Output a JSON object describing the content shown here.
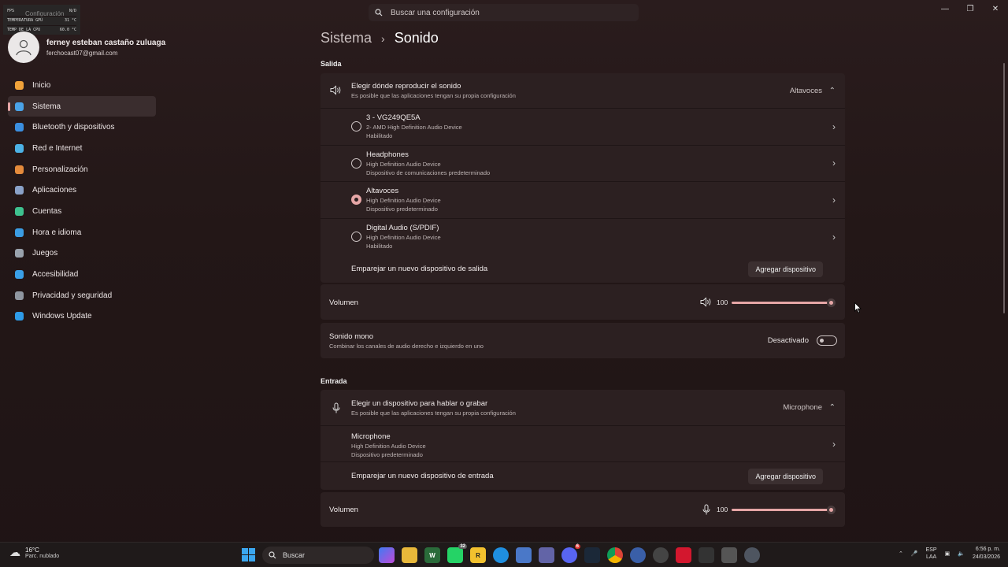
{
  "overlay": {
    "rows": [
      {
        "label": "FPS",
        "value": "N/D"
      },
      {
        "label": "TEMPERATURA GPU",
        "value": "31 °C"
      },
      {
        "label": "TEMP DE LA CPU",
        "value": "60.0 °C"
      }
    ],
    "app_title": "Configuración"
  },
  "search": {
    "placeholder": "Buscar una configuración"
  },
  "profile": {
    "name": "ferney esteban castaño zuluaga",
    "email": "ferchocast07@gmail.com"
  },
  "nav": [
    {
      "label": "Inicio",
      "icon": "home-icon",
      "color": "#f0a23a"
    },
    {
      "label": "Sistema",
      "icon": "system-icon",
      "color": "#4aa3e8",
      "active": true
    },
    {
      "label": "Bluetooth y dispositivos",
      "icon": "bluetooth-icon",
      "color": "#3b8fe0"
    },
    {
      "label": "Red e Internet",
      "icon": "network-icon",
      "color": "#4cb2e6"
    },
    {
      "label": "Personalización",
      "icon": "brush-icon",
      "color": "#e58b3c"
    },
    {
      "label": "Aplicaciones",
      "icon": "apps-icon",
      "color": "#8aa2c8"
    },
    {
      "label": "Cuentas",
      "icon": "accounts-icon",
      "color": "#3ec28f"
    },
    {
      "label": "Hora e idioma",
      "icon": "globe-icon",
      "color": "#3b9de3"
    },
    {
      "label": "Juegos",
      "icon": "gamepad-icon",
      "color": "#9aa3ad"
    },
    {
      "label": "Accesibilidad",
      "icon": "accessibility-icon",
      "color": "#3aa0e8"
    },
    {
      "label": "Privacidad y seguridad",
      "icon": "shield-icon",
      "color": "#8f96a0"
    },
    {
      "label": "Windows Update",
      "icon": "update-icon",
      "color": "#2e9be8"
    }
  ],
  "breadcrumb": {
    "parent": "Sistema",
    "current": "Sonido"
  },
  "output": {
    "section_label": "Salida",
    "header": {
      "title": "Elegir dónde reproducir el sonido",
      "subtitle": "Es posible que las aplicaciones tengan su propia configuración",
      "value": "Altavoces"
    },
    "devices": [
      {
        "name": "3 - VG249QE5A",
        "detail": "2- AMD High Definition Audio Device",
        "status": "Habilitado",
        "selected": false
      },
      {
        "name": "Headphones",
        "detail": "High Definition Audio Device",
        "status": "Dispositivo de comunicaciones predeterminado",
        "selected": false
      },
      {
        "name": "Altavoces",
        "detail": "High Definition Audio Device",
        "status": "Dispositivo predeterminado",
        "selected": true
      },
      {
        "name": "Digital Audio (S/PDIF)",
        "detail": "High Definition Audio Device",
        "status": "Habilitado",
        "selected": false
      }
    ],
    "pair": {
      "label": "Emparejar un nuevo dispositivo de salida",
      "button": "Agregar dispositivo"
    },
    "volume": {
      "label": "Volumen",
      "value": "100",
      "level": 1.0
    },
    "mono": {
      "title": "Sonido mono",
      "subtitle": "Combinar los canales de audio derecho e izquierdo en uno",
      "state": "Desactivado"
    }
  },
  "input": {
    "section_label": "Entrada",
    "header": {
      "title": "Elegir un dispositivo para hablar o grabar",
      "subtitle": "Es posible que las aplicaciones tengan su propia configuración",
      "value": "Microphone"
    },
    "devices": [
      {
        "name": "Microphone",
        "detail": "High Definition Audio Device",
        "status": "Dispositivo predeterminado"
      }
    ],
    "pair": {
      "label": "Emparejar un nuevo dispositivo de entrada",
      "button": "Agregar dispositivo"
    },
    "volume": {
      "label": "Volumen",
      "value": "100",
      "level": 1.0
    }
  },
  "taskbar": {
    "weather": {
      "temp": "16°C",
      "desc": "Parc. nublado"
    },
    "search_label": "Buscar",
    "badges": {
      "whatsapp": "32",
      "discord": "6"
    },
    "tray": {
      "lang1": "ESP",
      "lang2": "LAA",
      "time": "6:56 p. m.",
      "date": "24/03/2026"
    }
  }
}
